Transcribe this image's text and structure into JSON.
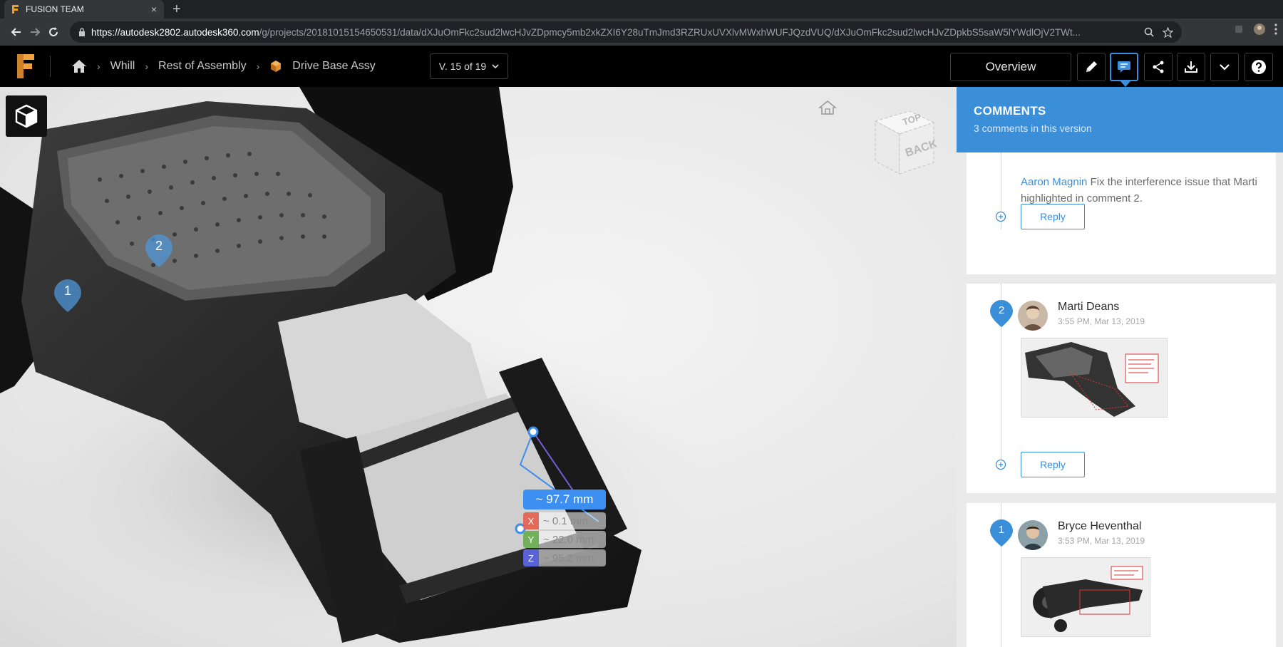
{
  "browser": {
    "tab": {
      "title": "FUSION TEAM",
      "close": "×"
    },
    "new_tab": "+",
    "url_host": "https://autodesk2802.autodesk360.com",
    "url_path": "/g/projects/20181015154650531/data/dXJuOmFkc2sud2lwcHJvZDpmcy5mb2xkZXI6Y28uTmJmd3RZRUxUVXlvMWxhWUFJQzdVUQ/dXJuOmFkc2sud2lwcHJvZDpkbS5saW5lYWdlOjV2TWt..."
  },
  "app": {
    "breadcrumb": [
      "Whill",
      "Rest of Assembly",
      "Drive Base Assy"
    ],
    "breadcrumb_sep": "›",
    "version": "V. 15 of 19",
    "overview_label": "Overview",
    "colors": {
      "accent": "#3b8fd9",
      "header_bg": "#000000",
      "measure": "#3c8ef1"
    }
  },
  "viewport": {
    "pins": [
      {
        "number": "2"
      },
      {
        "number": "1"
      }
    ],
    "measurement": {
      "total": "~ 97.7 mm",
      "x_axis": "X",
      "x_value": "~ 0.1 mm",
      "y_axis": "Y",
      "y_value": "~ 22.0 mm",
      "z_axis": "Z",
      "z_value": "~ 95.2 mm"
    },
    "nav_cube": {
      "top_face": "TOP",
      "front_face": "BACK"
    }
  },
  "comments": {
    "title": "COMMENTS",
    "subtitle": "3 comments in this version",
    "items": [
      {
        "mention": "Aaron Magnin",
        "text": " Fix the interference issue that Marti highlighted in comment 2.",
        "reply_label": "Reply"
      },
      {
        "number": "2",
        "author": "Marti Deans",
        "time": "3:55 PM, Mar 13, 2019",
        "reply_label": "Reply"
      },
      {
        "number": "1",
        "author": "Bryce Heventhal",
        "time": "3:53 PM, Mar 13, 2019"
      }
    ]
  }
}
